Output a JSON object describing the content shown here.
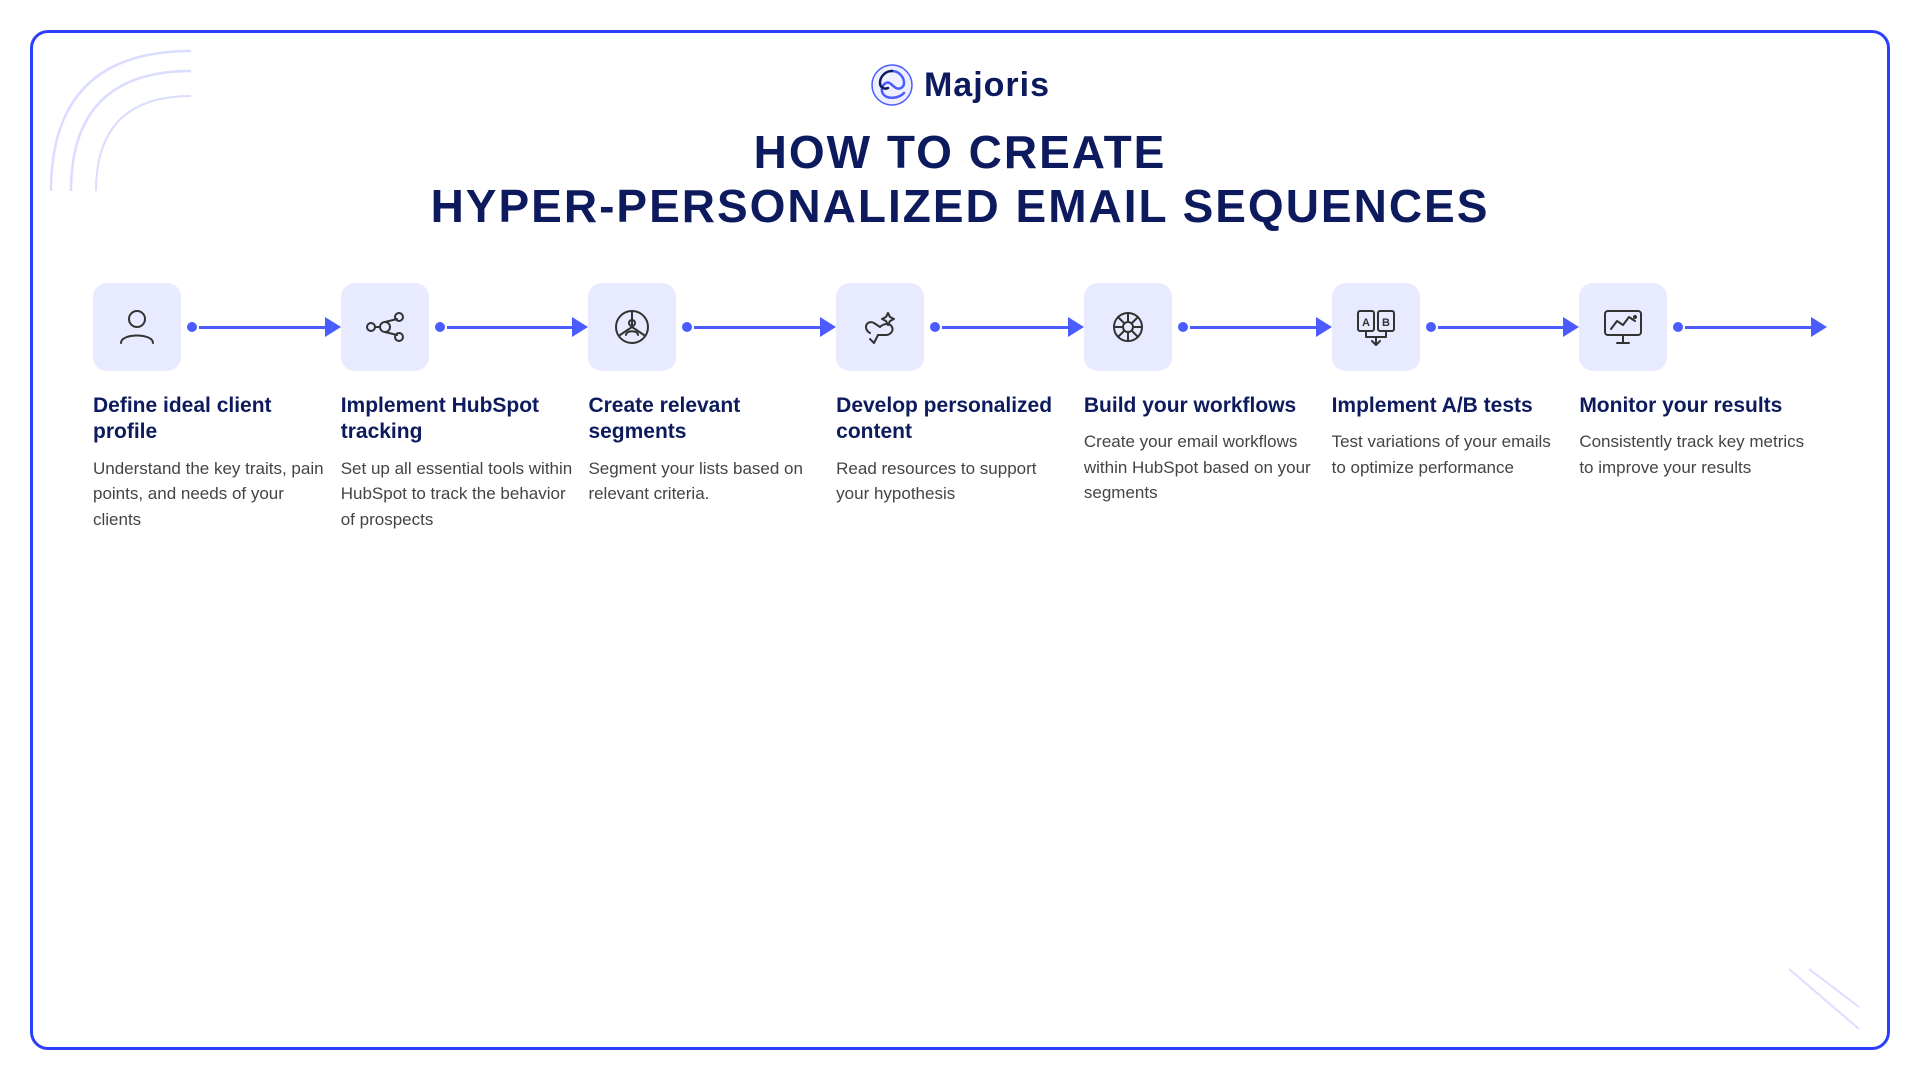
{
  "brand": {
    "name": "Majoris"
  },
  "title": {
    "line1": "HOW TO CREATE",
    "line2": "HYPER-PERSONALIZED EMAIL SEQUENCES"
  },
  "steps": [
    {
      "id": "step-1",
      "heading": "Define ideal client profile",
      "body": "Understand the key traits, pain points, and needs of your clients",
      "icon": "person"
    },
    {
      "id": "step-2",
      "heading": "Implement HubSpot tracking",
      "body": "Set up all essential tools within HubSpot to track the behavior of prospects",
      "icon": "hubspot"
    },
    {
      "id": "step-3",
      "heading": "Create relevant segments",
      "body": "Segment your lists based on relevant criteria.",
      "icon": "segments"
    },
    {
      "id": "step-4",
      "heading": "Develop personalized content",
      "body": "Read resources to support your hypothesis",
      "icon": "content"
    },
    {
      "id": "step-5",
      "heading": "Build your workflows",
      "body": "Create your email workflows within HubSpot based on your segments",
      "icon": "workflow"
    },
    {
      "id": "step-6",
      "heading": "Implement A/B tests",
      "body": "Test variations of your emails to optimize performance",
      "icon": "abtest"
    },
    {
      "id": "step-7",
      "heading": "Monitor your results",
      "body": "Consistently track key metrics to improve your results",
      "icon": "monitor"
    }
  ],
  "colors": {
    "brand_dark": "#0d1b5e",
    "accent": "#4a5cff",
    "icon_bg": "#e8eaff"
  }
}
